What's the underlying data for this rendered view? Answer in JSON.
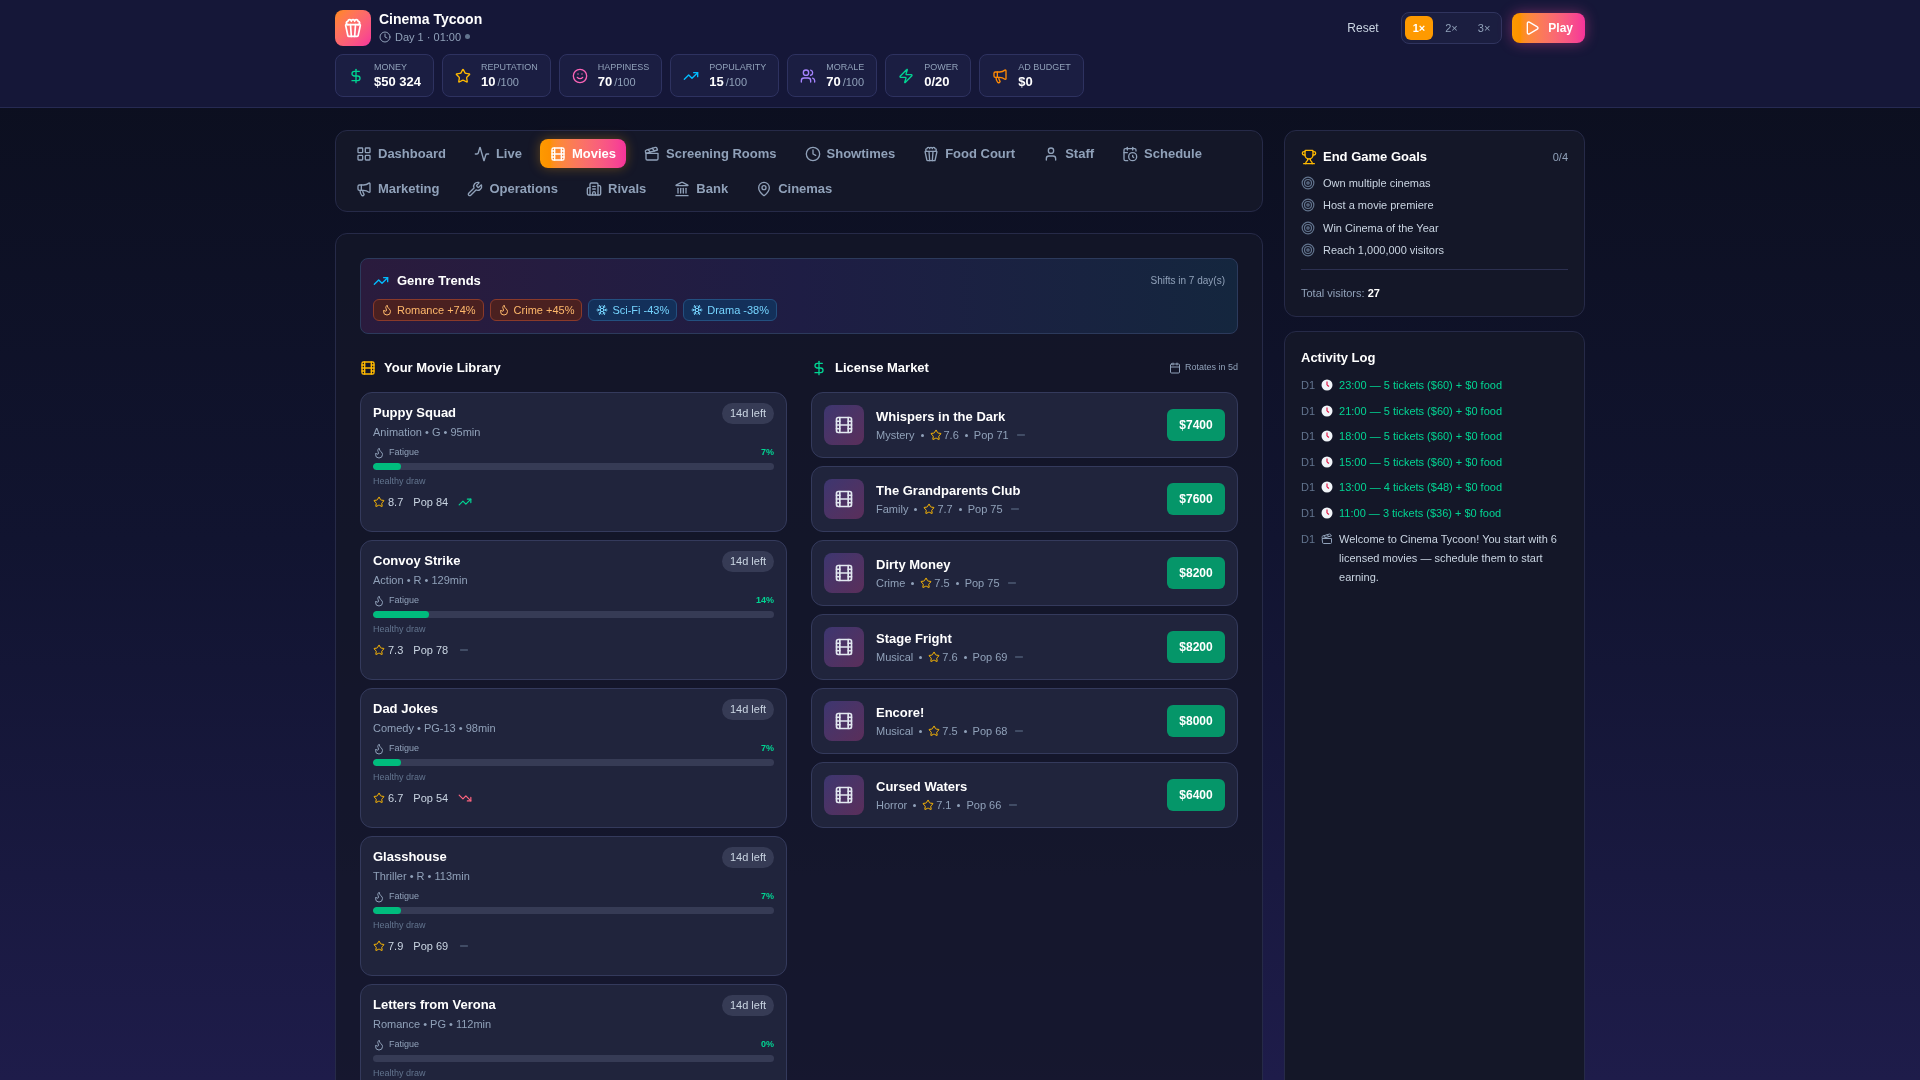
{
  "header": {
    "title": "Cinema Tycoon",
    "clock": "Day 1 · 01:00",
    "reset": "Reset",
    "speeds": [
      {
        "label": "1×",
        "selected": true
      },
      {
        "label": "2×",
        "selected": false
      },
      {
        "label": "3×",
        "selected": false
      }
    ],
    "play": "Play",
    "stats": [
      {
        "label": "MONEY",
        "value": "$50 324"
      },
      {
        "label": "REPUTATION",
        "value": "10",
        "max": "/100"
      },
      {
        "label": "HAPPINESS",
        "value": "70",
        "max": "/100"
      },
      {
        "label": "POPULARITY",
        "value": "15",
        "max": "/100"
      },
      {
        "label": "MORALE",
        "value": "70",
        "max": "/100"
      },
      {
        "label": "POWER",
        "value": "0/20"
      },
      {
        "label": "AD BUDGET",
        "value": "$0"
      }
    ]
  },
  "tabs": [
    {
      "label": "Dashboard",
      "selected": false
    },
    {
      "label": "Live",
      "selected": false
    },
    {
      "label": "Movies",
      "selected": true
    },
    {
      "label": "Screening Rooms",
      "selected": false
    },
    {
      "label": "Showtimes",
      "selected": false
    },
    {
      "label": "Food Court",
      "selected": false
    },
    {
      "label": "Staff",
      "selected": false
    },
    {
      "label": "Schedule",
      "selected": false
    },
    {
      "label": "Marketing",
      "selected": false
    },
    {
      "label": "Operations",
      "selected": false
    },
    {
      "label": "Rivals",
      "selected": false
    },
    {
      "label": "Bank",
      "selected": false
    },
    {
      "label": "Cinemas",
      "selected": false
    }
  ],
  "genre_trends": {
    "title": "Genre Trends",
    "shift_note": "Shifts in 7 day(s)",
    "tags": [
      {
        "label": "Romance +74%",
        "kind": "hot"
      },
      {
        "label": "Crime +45%",
        "kind": "hot"
      },
      {
        "label": "Sci-Fi -43%",
        "kind": "cold"
      },
      {
        "label": "Drama -38%",
        "kind": "cold"
      }
    ]
  },
  "library": {
    "title": "Your Movie Library",
    "movies": [
      {
        "title": "Puppy Squad",
        "meta": "Animation • G • 95min",
        "badge": "14d left",
        "fatigue_label": "Fatigue",
        "fatigue": "7%",
        "level": 0.07,
        "draw": "Healthy draw",
        "rating": "8.7",
        "pop": "Pop 84",
        "kind": "up"
      },
      {
        "title": "Convoy Strike",
        "meta": "Action • R • 129min",
        "badge": "14d left",
        "fatigue_label": "Fatigue",
        "fatigue": "14%",
        "level": 0.14,
        "draw": "Healthy draw",
        "rating": "7.3",
        "pop": "Pop 78",
        "kind": "flat"
      },
      {
        "title": "Dad Jokes",
        "meta": "Comedy • PG-13 • 98min",
        "badge": "14d left",
        "fatigue_label": "Fatigue",
        "fatigue": "7%",
        "level": 0.07,
        "draw": "Healthy draw",
        "rating": "6.7",
        "pop": "Pop 54",
        "kind": "down"
      },
      {
        "title": "Glasshouse",
        "meta": "Thriller • R • 113min",
        "badge": "14d left",
        "fatigue_label": "Fatigue",
        "fatigue": "7%",
        "level": 0.07,
        "draw": "Healthy draw",
        "rating": "7.9",
        "pop": "Pop 69",
        "kind": "flat"
      },
      {
        "title": "Letters from Verona",
        "meta": "Romance • PG • 112min",
        "badge": "14d left",
        "fatigue_label": "Fatigue",
        "fatigue": "0%",
        "draw": "Healthy draw"
      }
    ]
  },
  "market": {
    "title": "License Market",
    "rotates": "Rotates in 5d",
    "offers": [
      {
        "title": "Whispers in the Dark",
        "genre": "Mystery",
        "rating": "7.6",
        "pop": "Pop 71",
        "price": "$7400"
      },
      {
        "title": "The Grandparents Club",
        "genre": "Family",
        "rating": "7.7",
        "pop": "Pop 75",
        "price": "$7600"
      },
      {
        "title": "Dirty Money",
        "genre": "Crime",
        "rating": "7.5",
        "pop": "Pop 75",
        "price": "$8200"
      },
      {
        "title": "Stage Fright",
        "genre": "Musical",
        "rating": "7.6",
        "pop": "Pop 69",
        "price": "$8200"
      },
      {
        "title": "Encore!",
        "genre": "Musical",
        "rating": "7.5",
        "pop": "Pop 68",
        "price": "$8000"
      },
      {
        "title": "Cursed Waters",
        "genre": "Horror",
        "rating": "7.1",
        "pop": "Pop 66",
        "price": "$6400"
      }
    ]
  },
  "goals": {
    "title": "End Game Goals",
    "count": "0/4",
    "items": [
      {
        "label": "Own multiple cinemas",
        "done": false
      },
      {
        "label": "Host a movie premiere",
        "done": false
      },
      {
        "label": "Win Cinema of the Year",
        "done": false
      },
      {
        "label": "Reach 1,000,000 visitors",
        "done": false
      }
    ],
    "total": "Total visitors: **27**"
  },
  "activity": {
    "title": "Activity Log",
    "entries": [
      {
        "day": "D1",
        "kind": "showtime",
        "text": "23:00 — 5 tickets ($60) + $0 food"
      },
      {
        "day": "D1",
        "kind": "showtime",
        "text": "21:00 — 5 tickets ($60) + $0 food"
      },
      {
        "day": "D1",
        "kind": "showtime",
        "text": "18:00 — 5 tickets ($60) + $0 food"
      },
      {
        "day": "D1",
        "kind": "showtime",
        "text": "15:00 — 5 tickets ($60) + $0 food"
      },
      {
        "day": "D1",
        "kind": "showtime",
        "text": "13:00 — 4 tickets ($48) + $0 food"
      },
      {
        "day": "D1",
        "kind": "showtime",
        "text": "11:00 — 3 tickets ($36) + $0 food"
      },
      {
        "day": "D1",
        "kind": "info",
        "text": "Welcome to Cinema Tycoon! You start with 6 licensed movies — schedule them to start earning."
      }
    ]
  }
}
